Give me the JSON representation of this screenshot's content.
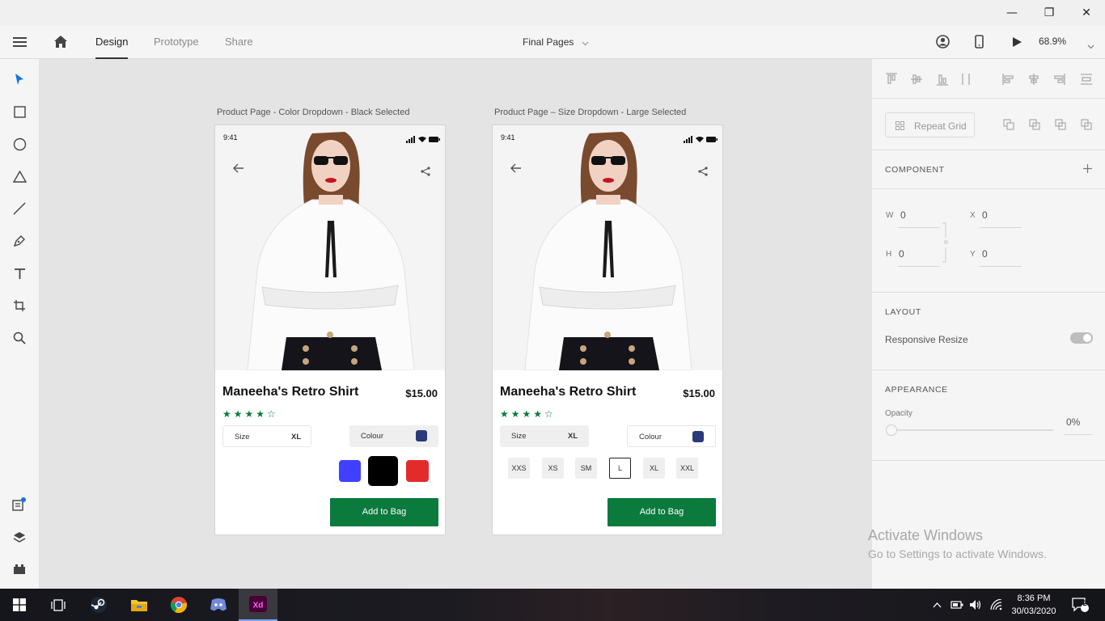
{
  "window": {
    "minimize": "—",
    "restore": "❐",
    "close": "✕"
  },
  "toolbar": {
    "tabs": [
      "Design",
      "Prototype",
      "Share"
    ],
    "document_title": "Final Pages",
    "zoom": "68.9%"
  },
  "artboards": [
    {
      "label": "Product Page - Color Dropdown - Black Selected",
      "status_time": "9:41",
      "product_name": "Maneeha's Retro Shirt",
      "price": "$15.00",
      "rating": 4,
      "stars": "★★★★☆",
      "size_label": "Size",
      "size_value": "XL",
      "colour_label": "Colour",
      "selected_colour": "#2b3a7a",
      "colour_options": [
        "#4040ff",
        "#000000",
        "#e32b2b"
      ],
      "add_to_bag": "Add to Bag"
    },
    {
      "label": "Product Page – Size Dropdown - Large Selected",
      "status_time": "9:41",
      "product_name": "Maneeha's Retro Shirt",
      "price": "$15.00",
      "rating": 4,
      "stars": "★★★★☆",
      "size_label": "Size",
      "size_value": "XL",
      "colour_label": "Colour",
      "selected_colour": "#2b3a7a",
      "size_options": [
        "XXS",
        "XS",
        "SM",
        "L",
        "XL",
        "XXL"
      ],
      "selected_size": "L",
      "add_to_bag": "Add to Bag"
    }
  ],
  "properties": {
    "repeat_grid": "Repeat Grid",
    "component_heading": "COMPONENT",
    "w_label": "W",
    "w_value": "0",
    "h_label": "H",
    "h_value": "0",
    "x_label": "X",
    "x_value": "0",
    "y_label": "Y",
    "y_value": "0",
    "layout_heading": "LAYOUT",
    "responsive_resize": "Responsive Resize",
    "appearance_heading": "APPEARANCE",
    "opacity_label": "Opacity",
    "opacity_value": "0%"
  },
  "watermark": {
    "line1": "Activate Windows",
    "line2": "Go to Settings to activate Windows."
  },
  "taskbar": {
    "time": "8:36 PM",
    "date": "30/03/2020",
    "notifications": "2"
  },
  "colors": {
    "accent_green": "#0a7a3d",
    "xd_icon": "#470137",
    "xd_pink": "#ff61f6",
    "selection_blue": "#1473e6"
  }
}
